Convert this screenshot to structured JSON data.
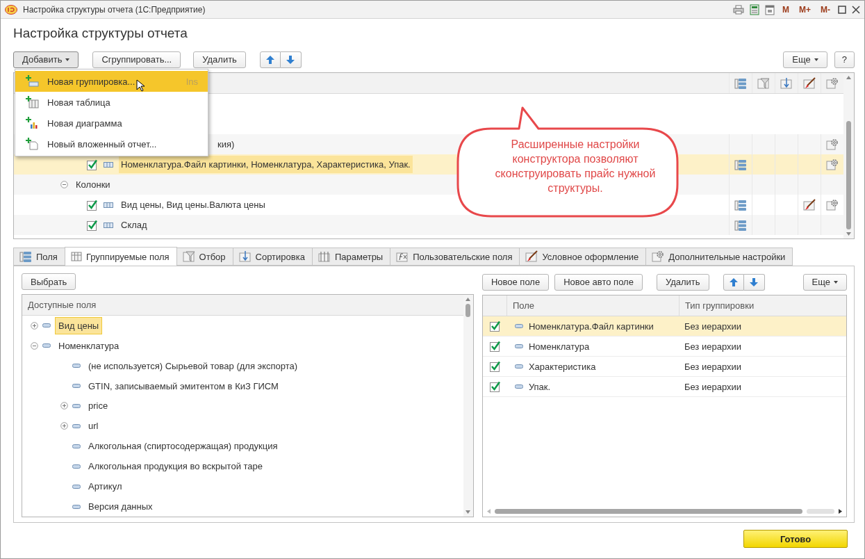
{
  "window": {
    "title": "Настройка структуры отчета  (1С:Предприятие)",
    "memory_keys": [
      "M",
      "M+",
      "M-"
    ]
  },
  "heading": "Настройка структуры отчета",
  "toolbar": {
    "add": "Добавить",
    "group": "Сгруппировать...",
    "delete": "Удалить",
    "more": "Еще",
    "help": "?"
  },
  "add_menu": [
    {
      "label": "Новая группировка...",
      "shortcut": "Ins",
      "selected": true
    },
    {
      "label": "Новая таблица",
      "selected": false
    },
    {
      "label": "Новая диаграмма",
      "selected": false
    },
    {
      "label": "Новый вложенный отчет...",
      "selected": false
    }
  ],
  "structure": {
    "rows": [
      {
        "text": "кия)",
        "covered": true,
        "fields": false,
        "filter": false,
        "order": false,
        "appearance": false,
        "settings": true,
        "selected": false,
        "children": [
          {
            "text": "Номенклатура.Файл картинки, Номенклатура, Характеристика, Упак.",
            "checked": true,
            "selected": true,
            "fields": true,
            "filter": false,
            "order": false,
            "appearance": false,
            "settings": true
          }
        ]
      },
      {
        "text": "Колонки",
        "expanded": true,
        "selected": false,
        "fields": false,
        "filter": false,
        "order": false,
        "appearance": false,
        "settings": false,
        "children": [
          {
            "text": "Вид цены, Вид цены.Валюта цены",
            "checked": true,
            "selected": false,
            "fields": true,
            "filter": false,
            "order": false,
            "appearance": true,
            "settings": true
          },
          {
            "text": "Склад",
            "checked": true,
            "selected": false,
            "fields": true,
            "filter": false,
            "order": false,
            "appearance": false,
            "settings": false
          }
        ]
      }
    ]
  },
  "callout": "Расширенные настройки конструктора позволяют сконструировать прайс нужной структуры.",
  "tabs": [
    {
      "label": "Поля",
      "selected": false
    },
    {
      "label": "Группируемые поля",
      "selected": true
    },
    {
      "label": "Отбор",
      "selected": false
    },
    {
      "label": "Сортировка",
      "selected": false
    },
    {
      "label": "Параметры",
      "selected": false
    },
    {
      "label": "Пользовательские поля",
      "selected": false
    },
    {
      "label": "Условное оформление",
      "selected": false
    },
    {
      "label": "Дополнительные настройки",
      "selected": false
    }
  ],
  "select_button": "Выбрать",
  "available_fields": {
    "header": "Доступные поля",
    "items": [
      {
        "label": "Вид цены",
        "expanded": false,
        "selected": true
      },
      {
        "label": "Номенклатура",
        "expanded": true,
        "selected": false,
        "children": [
          {
            "label": "(не используется) Сырьевой товар (для экспорта)",
            "selected": false
          },
          {
            "label": "GTIN, записываемый эмитентом в КиЗ ГИСМ",
            "selected": false
          },
          {
            "label": "price",
            "expanded": false,
            "selected": false
          },
          {
            "label": "url",
            "expanded": false,
            "selected": false
          },
          {
            "label": "Алкогольная (спиртосодержащая) продукция",
            "selected": false
          },
          {
            "label": "Алкогольная продукция во вскрытой таре",
            "selected": false
          },
          {
            "label": "Артикул",
            "selected": false
          },
          {
            "label": "Версия данных",
            "selected": false
          }
        ]
      }
    ]
  },
  "grouping_toolbar": {
    "new_field": "Новое поле",
    "new_auto_field": "Новое авто поле",
    "delete": "Удалить",
    "more": "Еще"
  },
  "grouping_table": {
    "columns": [
      "Поле",
      "Тип группировки"
    ],
    "rows": [
      {
        "checked": true,
        "field": "Номенклатура.Файл картинки",
        "type": "Без иерархии",
        "selected": true
      },
      {
        "checked": true,
        "field": "Номенклатура",
        "type": "Без иерархии",
        "selected": false
      },
      {
        "checked": true,
        "field": "Характеристика",
        "type": "Без иерархии",
        "selected": false
      },
      {
        "checked": true,
        "field": "Упак.",
        "type": "Без иерархии",
        "selected": false
      }
    ]
  },
  "done_button": "Готово"
}
